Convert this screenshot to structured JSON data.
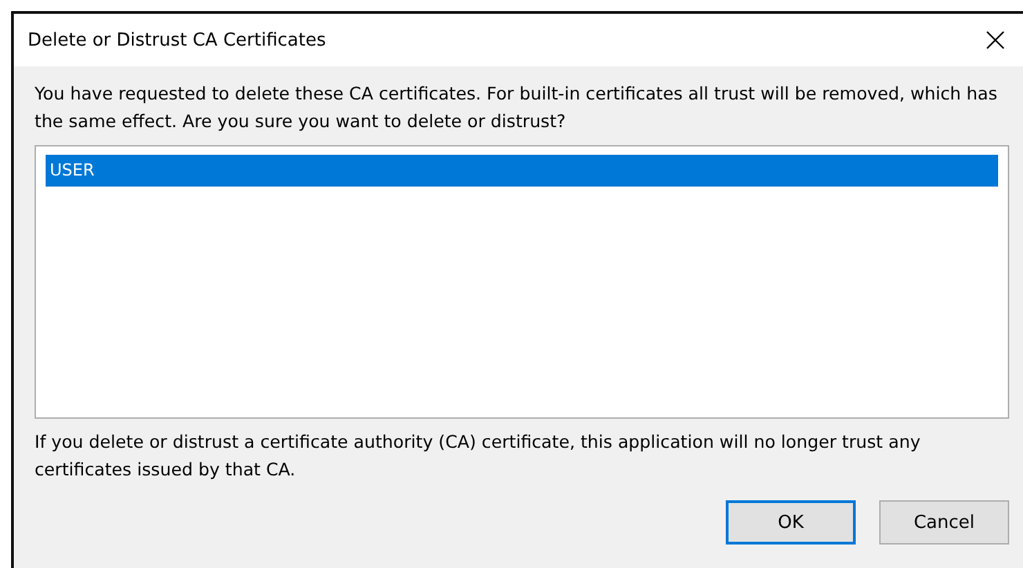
{
  "window": {
    "title": "Delete or Distrust CA Certificates"
  },
  "message": "You have requested to delete these CA certificates. For built-in certificates all trust will be removed, which has the same effect. Are you sure you want to delete or distrust?",
  "certificates": [
    {
      "label": "USER",
      "selected": true
    }
  ],
  "note": "If you delete or distrust a certificate authority (CA) certificate, this application will no longer trust any certificates issued by that CA.",
  "buttons": [
    {
      "label": "OK",
      "default": true
    },
    {
      "label": "Cancel",
      "default": false
    }
  ]
}
